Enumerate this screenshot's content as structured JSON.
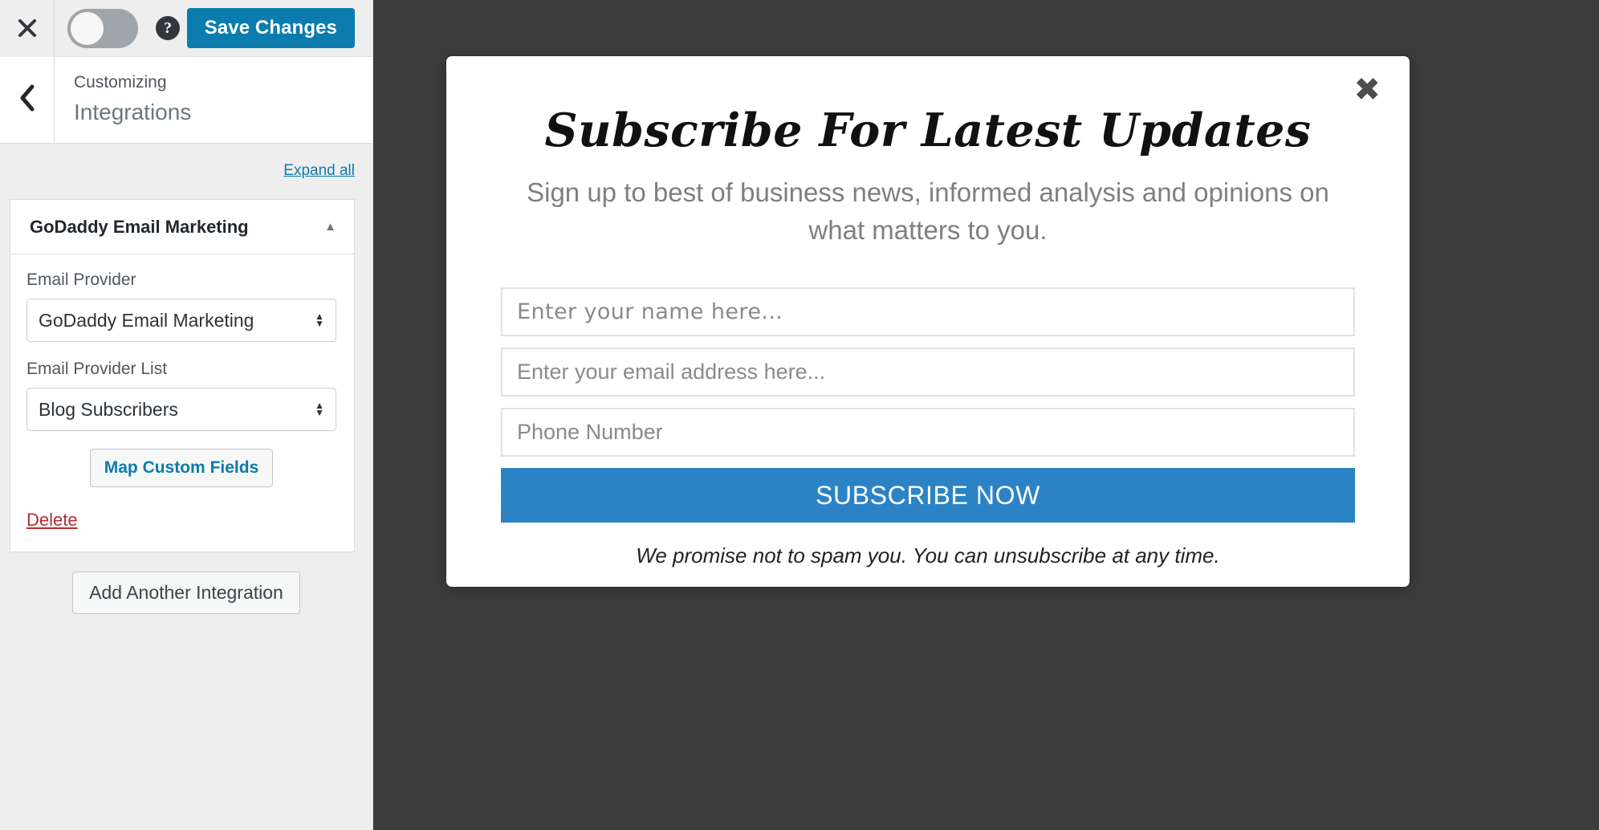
{
  "customizer": {
    "header": {
      "close_icon": "close-icon",
      "toggle": {
        "name": "device-preview-toggle",
        "state": "off"
      },
      "help_icon": "help-icon",
      "help_glyph": "?",
      "save_label": "Save Changes",
      "save_color": "#0b7cad"
    },
    "breadcrumb": {
      "back_icon": "chevron-left-icon",
      "eyebrow": "Customizing",
      "title": "Integrations"
    },
    "expand_all_label": "Expand all",
    "panel": {
      "title": "GoDaddy Email Marketing",
      "collapse_icon": "chevron-up-icon",
      "collapse_glyph": "▲",
      "fields": [
        {
          "label": "Email Provider",
          "value": "GoDaddy Email Marketing",
          "name": "email-provider-select"
        },
        {
          "label": "Email Provider List",
          "value": "Blog Subscribers",
          "name": "email-provider-list-select"
        }
      ],
      "map_fields_label": "Map Custom Fields",
      "delete_label": "Delete",
      "delete_color": "#b32d2e"
    },
    "add_integration_label": "Add Another Integration"
  },
  "preview": {
    "background_color": "#3c3c3c",
    "modal": {
      "close_icon": "close-icon",
      "close_glyph": "✖",
      "title": "Subscribe For Latest Updates",
      "subtitle": "Sign up to best of business news, informed analysis and opinions on what matters to you.",
      "fields": [
        {
          "name": "name-field",
          "placeholder": "Enter your name here..."
        },
        {
          "name": "email-field",
          "placeholder": "Enter your email address here..."
        },
        {
          "name": "phone-field",
          "placeholder": "Phone Number"
        }
      ],
      "submit_label": "SUBSCRIBE NOW",
      "submit_color": "#2b83c5",
      "note": "We promise not to spam you. You can unsubscribe at any time."
    }
  }
}
